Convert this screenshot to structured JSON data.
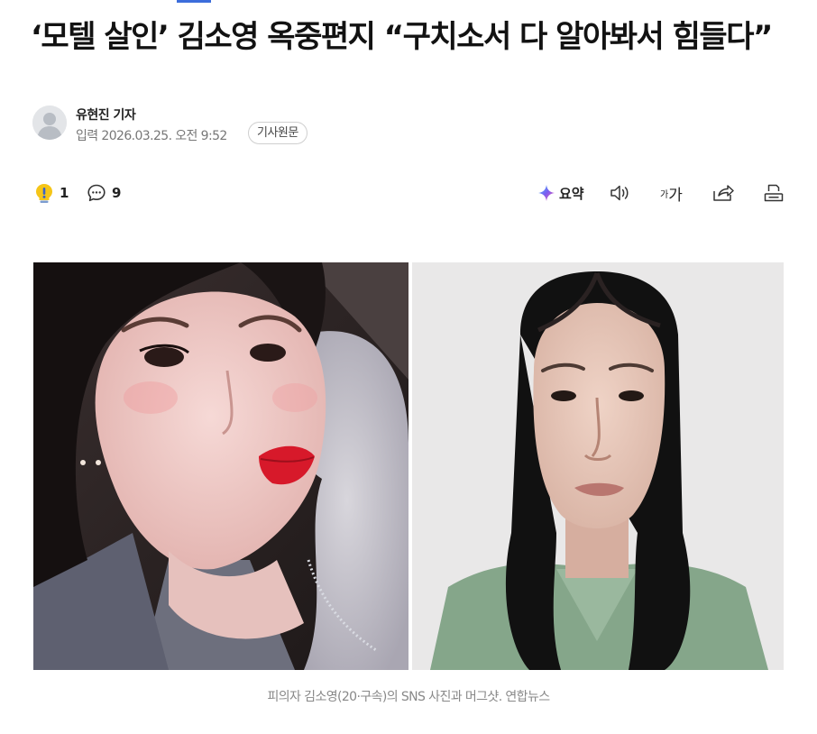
{
  "article": {
    "headline": "‘모텔 살인’ 김소영 옥중편지 “구치소서 다 알아봐서 힘들다”",
    "reporter": "유현진 기자",
    "published": "입력 2026.03.25. 오전 9:52",
    "original_link_label": "기사원문"
  },
  "toolbar": {
    "reaction": {
      "icon": "lightbulb-icon",
      "count": "1"
    },
    "comments": {
      "icon": "comment-icon",
      "count": "9"
    },
    "summary": {
      "icon": "sparkle-icon",
      "label": "요약"
    },
    "tts": {
      "icon": "speaker-icon"
    },
    "font_size": {
      "small": "가",
      "large": "가"
    },
    "share": {
      "icon": "share-icon"
    },
    "print": {
      "icon": "print-icon"
    }
  },
  "photo": {
    "caption": "피의자 김소영(20·구속)의 SNS 사진과 머그샷. 연합뉴스"
  },
  "colors": {
    "accent": "#3c6ddb",
    "reaction_bulb": "#f5c518",
    "summary_sparkle": "#7b5cf0",
    "caption_text": "#888888"
  }
}
